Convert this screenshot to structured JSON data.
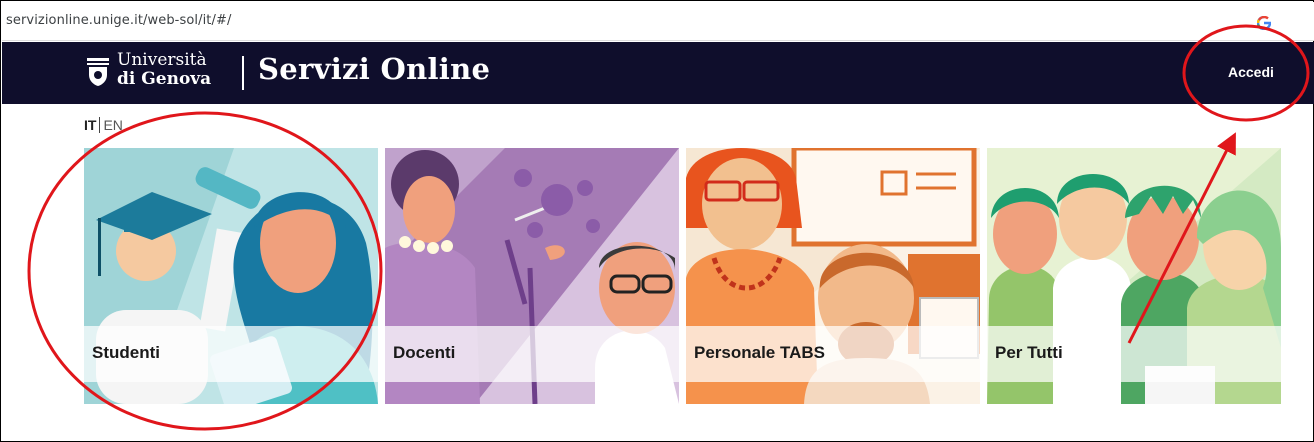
{
  "browser": {
    "url": "servizionline.unige.it/web-sol/it/#/"
  },
  "header": {
    "logo_line1": "Università",
    "logo_line2": "di Genova",
    "title": "Servizi Online",
    "login_label": "Accedi"
  },
  "language": {
    "active": "IT",
    "other": "EN"
  },
  "tiles": [
    {
      "label": "Studenti"
    },
    {
      "label": "Docenti"
    },
    {
      "label": "Personale TABS"
    },
    {
      "label": "Per Tutti"
    }
  ],
  "colors": {
    "header_bg": "#0f0e2c",
    "annotation_red": "#e0161b",
    "studenti_bg": "#bfe4e6",
    "docenti_bg": "#a57bb5",
    "personale_bg": "#f6e7d3",
    "pertutti_bg": "#e7f2d3"
  }
}
